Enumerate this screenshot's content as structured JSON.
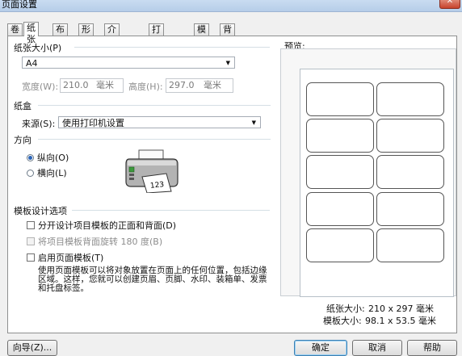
{
  "window": {
    "title": "页面设置",
    "close_glyph": "✕"
  },
  "tabs": [
    "卷",
    "纸张",
    "布局",
    "形状",
    "介质处理",
    "打印顺序",
    "模板",
    "背景"
  ],
  "paper_size": {
    "group": "纸张大小(P)",
    "selected": "A4",
    "width_label": "宽度(W):",
    "width_value": "210.0",
    "width_unit": "毫米",
    "height_label": "高度(H):",
    "height_value": "297.0",
    "height_unit": "毫米"
  },
  "tray": {
    "group": "纸盒",
    "source_label": "来源(S):",
    "source_value": "使用打印机设置"
  },
  "orientation": {
    "group": "方向",
    "portrait": "纵向(O)",
    "landscape": "横向(L)",
    "selected": "portrait",
    "printer_sheet_text": "123"
  },
  "template_options": {
    "group": "模板设计选项",
    "opt1": "分开设计项目模板的正面和背面(D)",
    "opt2": "将项目模板背面旋转 180 度(B)",
    "opt3": "启用页面模板(T)",
    "description": "使用页面模板可以将对象放置在页面上的任何位置，包括边缘区域。这样，您就可以创建页眉、页脚、水印、装箱单、发票和托盘标签。"
  },
  "preview": {
    "label": "预览:",
    "rows": 5,
    "cols": 2,
    "paper_size_label": "纸张大小:",
    "paper_size_value": "210 x 297 毫米",
    "template_size_label": "模板大小:",
    "template_size_value": "98.1 x 53.5 毫米"
  },
  "buttons": {
    "wizard": "向导(Z)...",
    "ok": "确定",
    "cancel": "取消",
    "help": "帮助"
  }
}
